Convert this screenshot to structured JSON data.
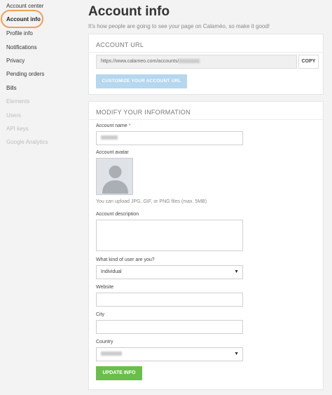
{
  "sidebar": {
    "items": [
      {
        "label": "Account center"
      },
      {
        "label": "Account info"
      },
      {
        "label": "Profile info"
      },
      {
        "label": "Notifications"
      },
      {
        "label": "Privacy"
      },
      {
        "label": "Pending orders"
      },
      {
        "label": "Bills"
      },
      {
        "label": "Elements"
      },
      {
        "label": "Users"
      },
      {
        "label": "API keys"
      },
      {
        "label": "Google Analytics"
      }
    ]
  },
  "header": {
    "title": "Account info",
    "subtitle": "It's how people are going to see your page on Calaméo, so make it good!"
  },
  "account_url": {
    "heading": "ACCOUNT URL",
    "url_prefix": "https://www.calameo.com/accounts/",
    "copy_label": "COPY",
    "customize_label": "CUSTOMIZE YOUR ACCOUNT URL"
  },
  "modify": {
    "heading": "MODIFY YOUR INFORMATION",
    "account_name_label": "Account name",
    "required_mark": "*",
    "avatar_label": "Account avatar",
    "avatar_help": "You can upload JPG, GIF, or PNG files (max. 5MB)",
    "description_label": "Account description",
    "user_kind_label": "What kind of user are you?",
    "user_kind_value": "Individual",
    "website_label": "Website",
    "city_label": "City",
    "country_label": "Country",
    "update_label": "UPDATE INFO"
  },
  "colors": {
    "highlight_ring": "#f0a05a",
    "customize_button": "#b5d7ef",
    "update_button": "#6abf4b"
  }
}
